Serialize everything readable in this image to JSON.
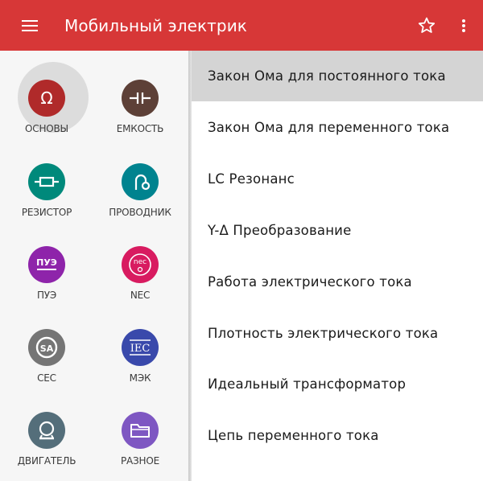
{
  "app": {
    "title": "Мобильный электрик"
  },
  "colors": {
    "appbar": "#d73737",
    "osnovy": "#b02a2a",
    "emkost": "#5d4037",
    "rezistor": "#00897b",
    "provodnik": "#00838f",
    "pue": "#8e24aa",
    "nec": "#d81b60",
    "cec": "#757575",
    "mek": "#3949ab",
    "dvigatel": "#546e7a",
    "raznoe": "#7e57c2"
  },
  "categories": [
    {
      "label": "ОСНОВЫ",
      "icon": "omega-icon"
    },
    {
      "label": "ЕМКОСТЬ",
      "icon": "capacitor-icon"
    },
    {
      "label": "РЕЗИСТОР",
      "icon": "resistor-icon"
    },
    {
      "label": "ПРОВОДНИК",
      "icon": "conductor-icon"
    },
    {
      "label": "ПУЭ",
      "icon": "pue-icon",
      "badge": "ПУЭ"
    },
    {
      "label": "NEC",
      "icon": "nec-icon",
      "badge": "nec"
    },
    {
      "label": "CEC",
      "icon": "csa-icon",
      "badge": "SA"
    },
    {
      "label": "МЭК",
      "icon": "iec-icon",
      "badge": "IEC"
    },
    {
      "label": "ДВИГАТЕЛЬ",
      "icon": "motor-icon"
    },
    {
      "label": "РАЗНОЕ",
      "icon": "folder-icon"
    }
  ],
  "topics": [
    "Закон Ома для постоянного тока",
    "Закон Ома для переменного тока",
    "LC Резонанс",
    "Y-Δ Преобразование",
    "Работа электрического тока",
    "Плотность электрического тока",
    "Идеальный трансформатор",
    "Цепь переменного тока"
  ]
}
